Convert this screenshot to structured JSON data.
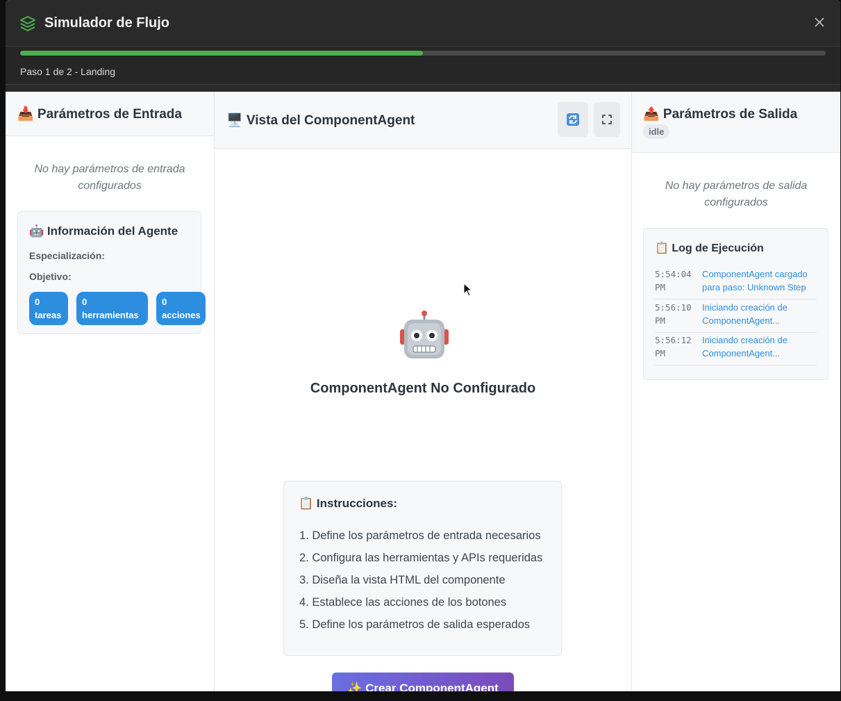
{
  "modal": {
    "title": "Simulador de Flujo",
    "close_icon": "close-icon",
    "title_icon": "layers-icon"
  },
  "progress": {
    "label": "Paso 1 de 2 - Landing",
    "percent": 50,
    "color": "#4caf50"
  },
  "input_panel": {
    "title": "📥 Parámetros de Entrada",
    "empty_message": "No hay parámetros de entrada configurados",
    "agent_info": {
      "title": "🤖 Información del Agente",
      "specialization_label": "Especialización:",
      "objective_label": "Objetivo:",
      "badges": [
        {
          "count": "0",
          "label": "tareas"
        },
        {
          "count": "0",
          "label": "herramientas"
        },
        {
          "count": "0",
          "label": "acciones"
        }
      ]
    }
  },
  "view_panel": {
    "title": "🖥️ Vista del ComponentAgent",
    "refresh_icon": "refresh-icon",
    "fullscreen_icon": "fullscreen-icon",
    "robot_icon": "robot-icon",
    "status_heading": "ComponentAgent No Configurado",
    "instructions": {
      "title": "📋 Instrucciones:",
      "items": [
        "1. Define los parámetros de entrada necesarios",
        "2. Configura las herramientas y APIs requeridas",
        "3. Diseña la vista HTML del componente",
        "4. Establece las acciones de los botones",
        "5. Define los parámetros de salida esperados"
      ]
    },
    "create_button": "✨ Crear ComponentAgent"
  },
  "output_panel": {
    "title": "📤 Parámetros de Salida",
    "status": "idle",
    "empty_message": "No hay parámetros de salida configurados",
    "log": {
      "title": "📋 Log de Ejecución",
      "entries": [
        {
          "time": "5:54:04 PM",
          "message": "ComponentAgent cargado para paso: Unknown Step"
        },
        {
          "time": "5:56:10 PM",
          "message": "Iniciando creación de ComponentAgent..."
        },
        {
          "time": "5:56:12 PM",
          "message": "Iniciando creación de ComponentAgent..."
        }
      ]
    }
  },
  "colors": {
    "accent": "#2d8ee0",
    "progress": "#4caf50",
    "button_gradient_start": "#6a6fe0",
    "button_gradient_end": "#7a4bb8"
  }
}
